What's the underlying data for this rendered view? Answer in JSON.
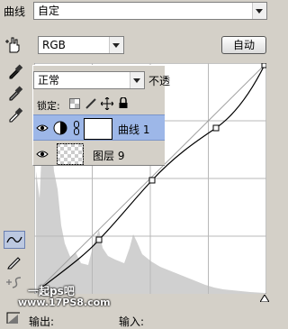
{
  "top": {
    "label": "曲线",
    "preset_value": "自定"
  },
  "channel": {
    "value": "RGB",
    "auto_button": "自动"
  },
  "layers": {
    "blend_mode": "正常",
    "opacity_label": "不透",
    "lock_label": "锁定:",
    "rows": [
      {
        "name": "曲线 1",
        "selected": true
      },
      {
        "name": "图层 9",
        "selected": false
      }
    ]
  },
  "bottom": {
    "output_label": "输出:",
    "input_label": "输入:"
  },
  "watermark": {
    "line1": "一起ps吧",
    "line2": "www.17PS8.com"
  },
  "colors": {
    "selection": "#9db7e8",
    "dialog_bg": "#d4d0c8",
    "curve_line": "#000000"
  }
}
